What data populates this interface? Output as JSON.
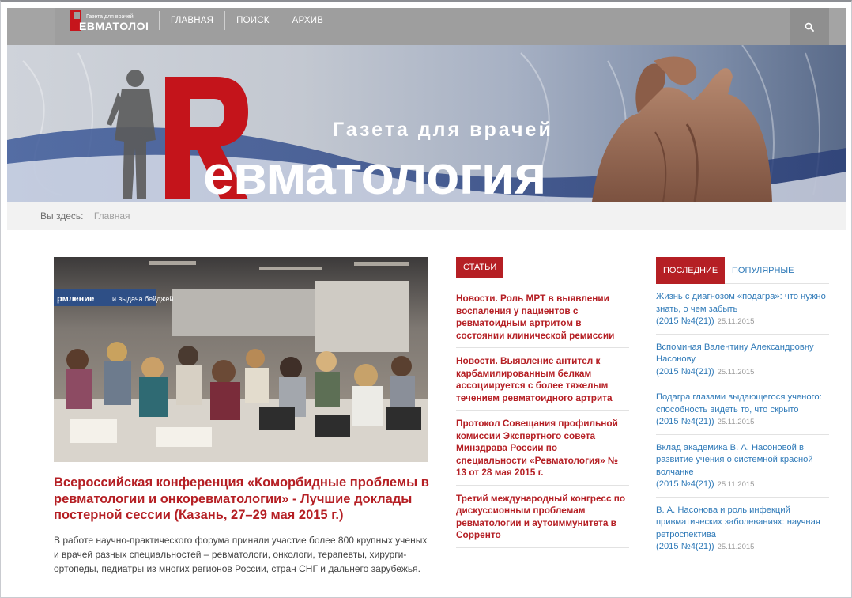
{
  "header": {
    "logo_text_small": "Газета для врачей",
    "logo_text_big": "Ревматология",
    "nav": [
      "ГЛАВНАЯ",
      "ПОИСК",
      "АРХИВ"
    ]
  },
  "banner": {
    "tagline": "Газета для врачей",
    "title_big_letter": "Р",
    "title_rest": "евматология"
  },
  "breadcrumb": {
    "label": "Вы здесь:",
    "current": "Главная"
  },
  "lead": {
    "title": "Всероссийская конференция «Коморбидные проблемы в ревматологии и онкоревматологии» - Лучшие доклады постерной сессии (Казань, 27–29 мая 2015 г.)",
    "text": "В работе научно-практического форума приняли участие более 800 крупных ученых и врачей разных специальностей – ревматологи, онкологи, терапевты, хирурги-ортопеды, педиатры из многих регионов России, стран СНГ и дальнего зарубежья.",
    "photo_sign_1": "рмление",
    "photo_sign_2": "и выдача бейджей"
  },
  "articles": {
    "badge": "СТАТЬИ",
    "items": [
      "Новости. Роль МРТ в выявлении воспаления у пациентов с ревматоидным артритом в состоянии клинической ремиссии",
      "Новости. Выявление антител к карбамилированным белкам ассоциируется с более тяжелым течением ревматоидного артрита",
      "Протокол Совещания профильной комиссии Экспертного совета Минздрава России по специальности «Ревматология» № 13 от 28 мая 2015 г.",
      "Третий международный конгресс по дискуссионным проблемам ревматологии и аутоиммунитета в Сорренто"
    ]
  },
  "tabs": {
    "latest": "ПОСЛЕДНИЕ",
    "popular": "ПОПУЛЯРНЫЕ"
  },
  "latest": [
    {
      "title": "Жизнь с диагнозом «подагра»: что нужно знать, о чем забыть",
      "issue": "(2015 №4(21))",
      "date": "25.11.2015"
    },
    {
      "title": "Вспоминая Валентину Александровну Насонову",
      "issue": "(2015 №4(21))",
      "date": "25.11.2015"
    },
    {
      "title": "Подагра глазами выдающегося ученого: способность видеть то, что скрыто",
      "issue": "(2015 №4(21))",
      "date": "25.11.2015"
    },
    {
      "title": "Вклад академика В. А. Насоновой в развитие учения о системной красной волчанке",
      "issue": "(2015 №4(21))",
      "date": "25.11.2015"
    },
    {
      "title": "В. А. Насонова и роль инфекций привматических заболеваниях: научная ретроспектива",
      "issue": "(2015 №4(21))",
      "date": "25.11.2015"
    }
  ],
  "colors": {
    "accent": "#b51f24",
    "link": "#2f7ab8",
    "topbar": "#9e9e9e"
  }
}
